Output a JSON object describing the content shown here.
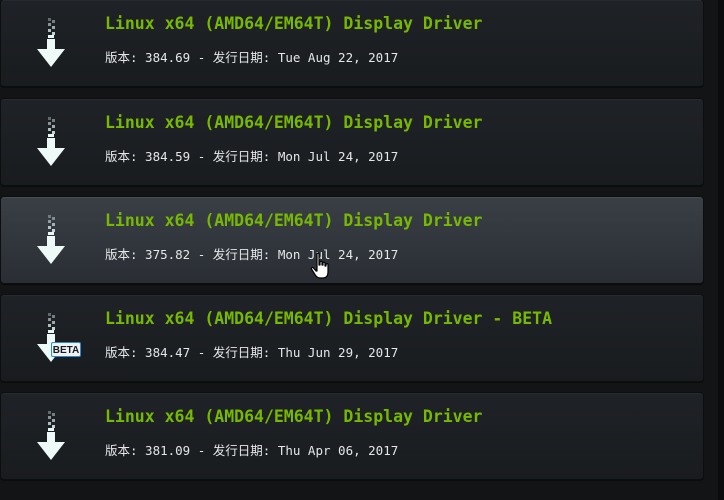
{
  "drivers": [
    {
      "title": "Linux x64 (AMD64/EM64T) Display Driver",
      "meta": "版本: 384.69 - 发行日期: Tue Aug 22, 2017",
      "icon": "download-arrow-icon",
      "beta": false
    },
    {
      "title": "Linux x64 (AMD64/EM64T) Display Driver",
      "meta": "版本: 384.59 - 发行日期: Mon Jul 24, 2017",
      "icon": "download-arrow-icon",
      "beta": false
    },
    {
      "title": "Linux x64 (AMD64/EM64T) Display Driver",
      "meta": "版本: 375.82 - 发行日期: Mon Jul 24, 2017",
      "icon": "download-arrow-icon",
      "beta": false,
      "hovered": true
    },
    {
      "title": "Linux x64 (AMD64/EM64T) Display Driver - BETA",
      "meta": "版本: 384.47 - 发行日期: Thu Jun 29, 2017",
      "icon": "download-arrow-icon",
      "beta": true,
      "beta_label": "BETA"
    },
    {
      "title": "Linux x64 (AMD64/EM64T) Display Driver",
      "meta": "版本: 381.09 - 发行日期: Thu Apr 06, 2017",
      "icon": "download-arrow-icon",
      "beta": false
    }
  ],
  "colors": {
    "title_green": "#76b900",
    "meta_text": "#e4e6e8",
    "beta_border": "#2a8ad4"
  }
}
